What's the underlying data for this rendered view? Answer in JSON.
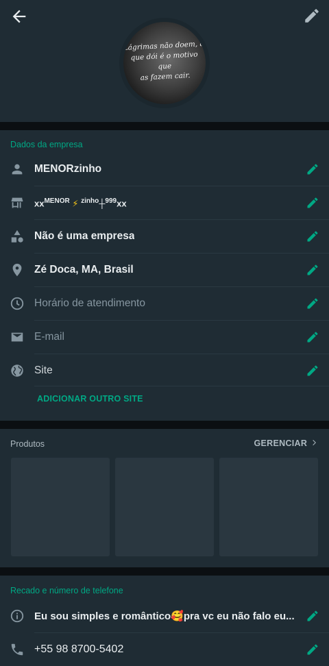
{
  "header": {
    "back_icon": "arrow-left-icon",
    "edit_icon": "pencil-icon",
    "avatar_caption": [
      "Lágrimas não doem, a",
      "que dói é o motivo que",
      "as fazem cair."
    ]
  },
  "business": {
    "section_title": "Dados da empresa",
    "rows": [
      {
        "icon": "person-icon",
        "text": "MENORzinho",
        "muted": false
      },
      {
        "icon": "store-icon",
        "text_parts": [
          "xx",
          "MENOR",
          "⚡",
          "zinho",
          "┼",
          "999",
          "xx"
        ],
        "muted": false
      },
      {
        "icon": "category-icon",
        "text": "Não é uma empresa",
        "muted": false
      },
      {
        "icon": "location-pin-icon",
        "text": "Zé Doca, MA, Brasil",
        "muted": false
      },
      {
        "icon": "clock-icon",
        "text": "Horário de atendimento",
        "muted": true
      },
      {
        "icon": "mail-icon",
        "text": "E-mail",
        "muted": true
      },
      {
        "icon": "globe-icon",
        "text": "Site",
        "muted": false
      }
    ],
    "add_site_label": "ADICIONAR OUTRO SITE"
  },
  "products": {
    "title": "Produtos",
    "manage_label": "GERENCIAR",
    "thumbnails": 3
  },
  "about": {
    "section_title": "Recado e número de telefone",
    "status_text": "Eu sou simples e romântico🥰pra vc eu não falo eu...",
    "phone": "+55 98 8700-5402"
  },
  "colors": {
    "accent": "#00a884",
    "card": "#1f2c34",
    "background": "#0b0f12",
    "icon": "#8696a0"
  }
}
